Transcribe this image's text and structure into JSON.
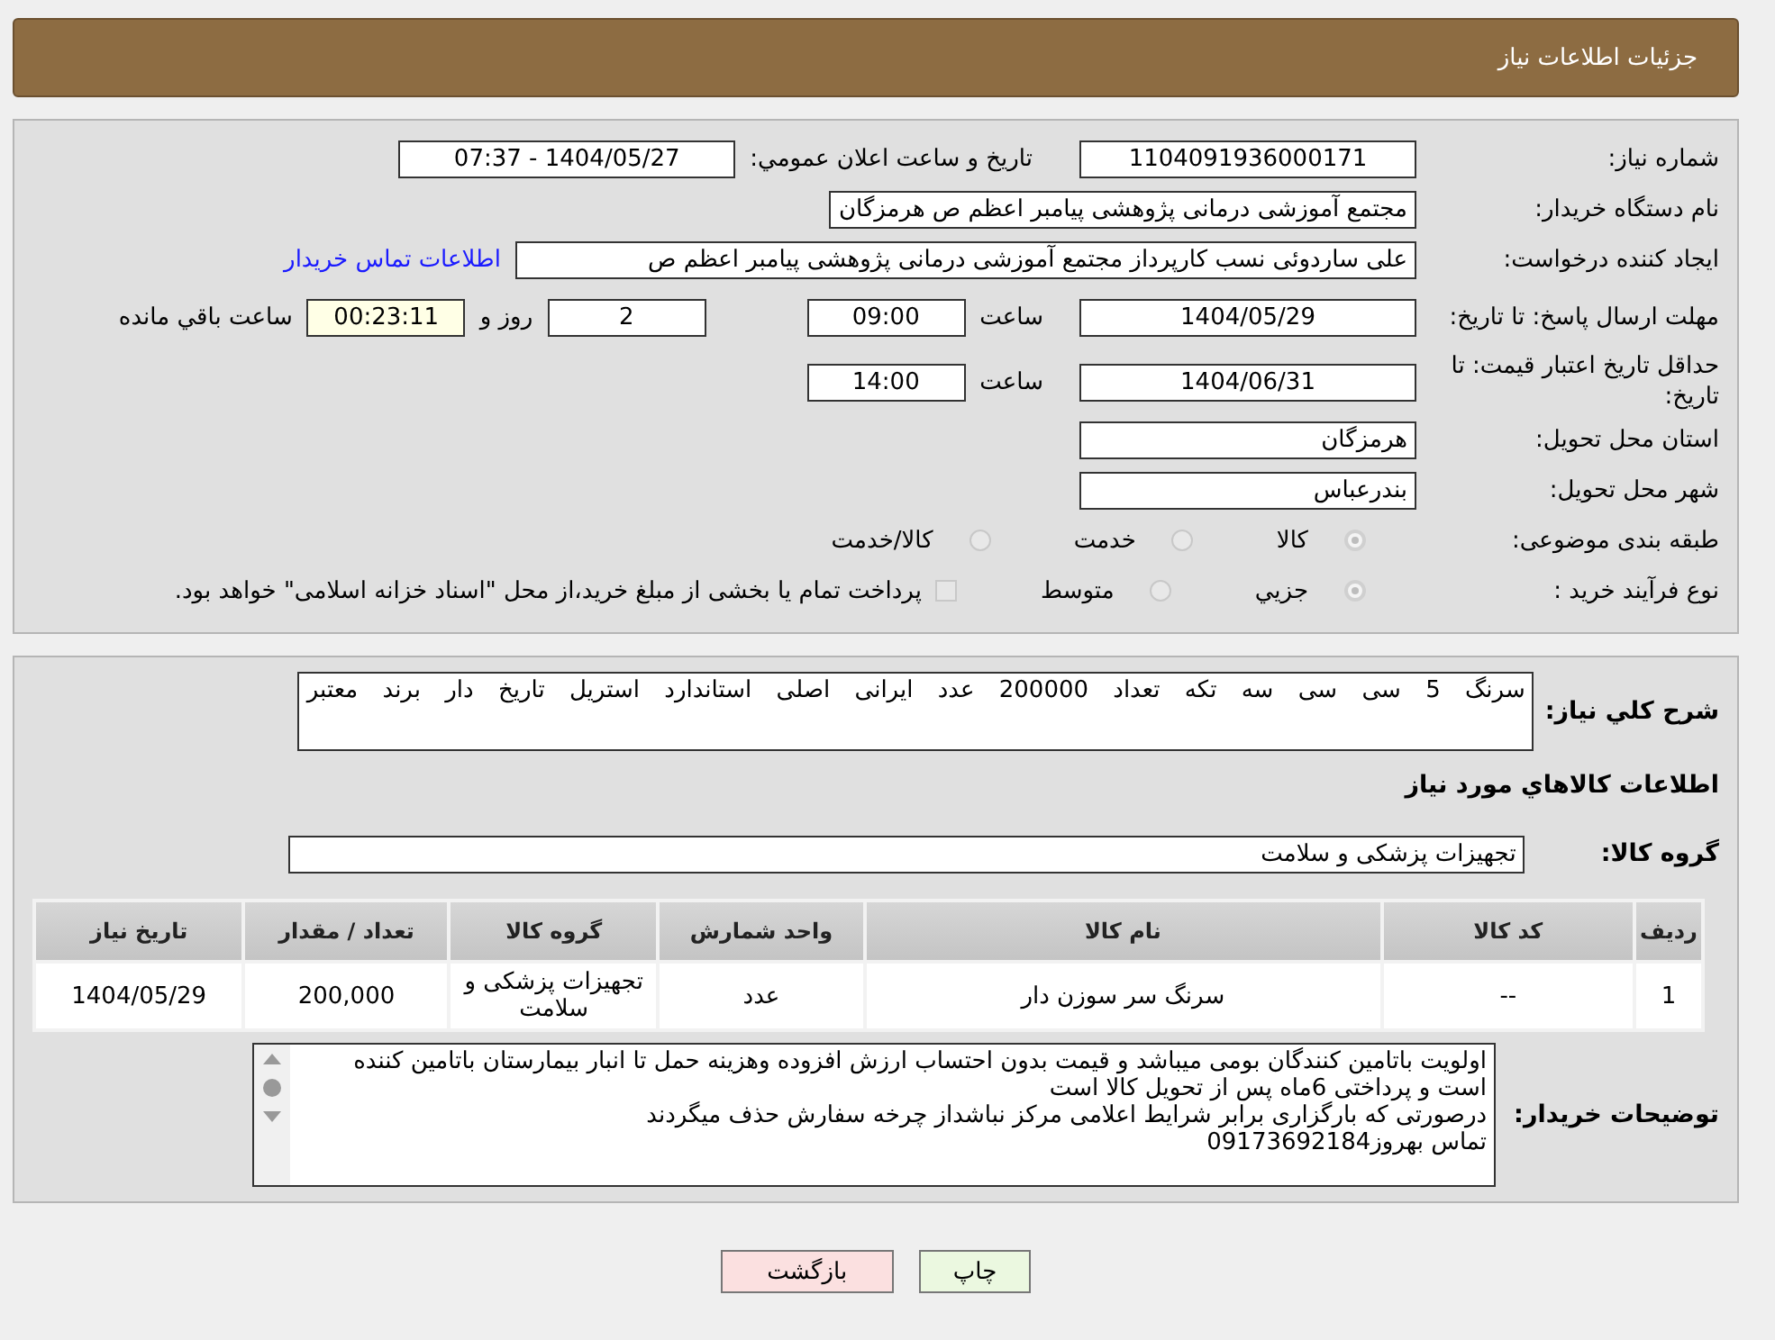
{
  "header": {
    "title": "جزئیات اطلاعات نیاز"
  },
  "details": {
    "need_number": {
      "label": "شماره نیاز:",
      "value": "1104091936000171"
    },
    "announce": {
      "label": "تاريخ و ساعت اعلان عمومي:",
      "value": "1404/05/27 - 07:37"
    },
    "buyer": {
      "label": "نام دستگاه خریدار:",
      "value": "مجتمع آموزشی درمانی پژوهشی پیامبر اعظم ص  هرمزگان"
    },
    "creator": {
      "label": "ایجاد کننده درخواست:",
      "value": "علی ساردوئی نسب کارپرداز مجتمع آموزشی درمانی پژوهشی پیامبر اعظم ص",
      "link": "اطلاعات تماس خریدار"
    },
    "deadline": {
      "label": "مهلت ارسال پاسخ: تا تاریخ:",
      "date": "1404/05/29",
      "time_label": "ساعت",
      "time": "09:00",
      "days": "2",
      "days_label": "روز و",
      "remaining": "00:23:11",
      "remaining_label": "ساعت باقي مانده"
    },
    "validity": {
      "label": "حداقل تاریخ اعتبار قیمت: تا تاریخ:",
      "date": "1404/06/31",
      "time_label": "ساعت",
      "time": "14:00"
    },
    "province": {
      "label": "استان محل تحویل:",
      "value": "هرمزگان"
    },
    "city": {
      "label": "شهر محل تحویل:",
      "value": "بندرعباس"
    },
    "category": {
      "label": "طبقه بندی موضوعی:",
      "options": [
        {
          "label": "کالا",
          "selected": true
        },
        {
          "label": "خدمت",
          "selected": false
        },
        {
          "label": "کالا/خدمت",
          "selected": false
        }
      ]
    },
    "process": {
      "label": "نوع فرآیند خرید :",
      "options": [
        {
          "label": "جزيي",
          "selected": true
        },
        {
          "label": "متوسط",
          "selected": false
        }
      ],
      "treasury": {
        "checked": false,
        "text": "پرداخت تمام یا بخشی از مبلغ خرید،از محل \"اسناد خزانه اسلامی\" خواهد بود."
      }
    }
  },
  "need": {
    "description_label": "شرح كلي نياز:",
    "description": "سرنگ 5 سی سی  سه  تکه  تعداد 200000 عدد  ایرانی  اصلی  استاندارد  استریل  تاریخ  دار  برند  معتبر",
    "items_heading": "اطلاعات كالاهاي مورد نياز",
    "group_label": "گروه کالا:",
    "group": "تجهیزات پزشکی و سلامت",
    "table": {
      "columns": [
        "ردیف",
        "کد کالا",
        "نام کالا",
        "واحد شمارش",
        "گروه کالا",
        "تعداد / مقدار",
        "تاریخ نیاز"
      ],
      "rows": [
        [
          "1",
          "--",
          "سرنگ سر سوزن دار",
          "عدد",
          "تجهیزات پزشکی و سلامت",
          "200,000",
          "1404/05/29"
        ]
      ]
    },
    "notes_label": "توضیحات خریدار:",
    "notes": "اولویت باتامین کنندگان بومی میباشد و قیمت بدون احتساب ارزش افزوده وهزینه حمل تا انبار بیمارستان باتامین کننده است و پرداختی 6ماه پس از تحویل کالا است\nدرصورتی که بارگزاری برابر شرایط اعلامی مرکز نباشداز چرخه سفارش حذف میگردند\nتماس بهروز09173692184"
  },
  "buttons": [
    {
      "kind": "print",
      "label": "چاپ"
    },
    {
      "kind": "back",
      "label": "بازگشت"
    }
  ]
}
